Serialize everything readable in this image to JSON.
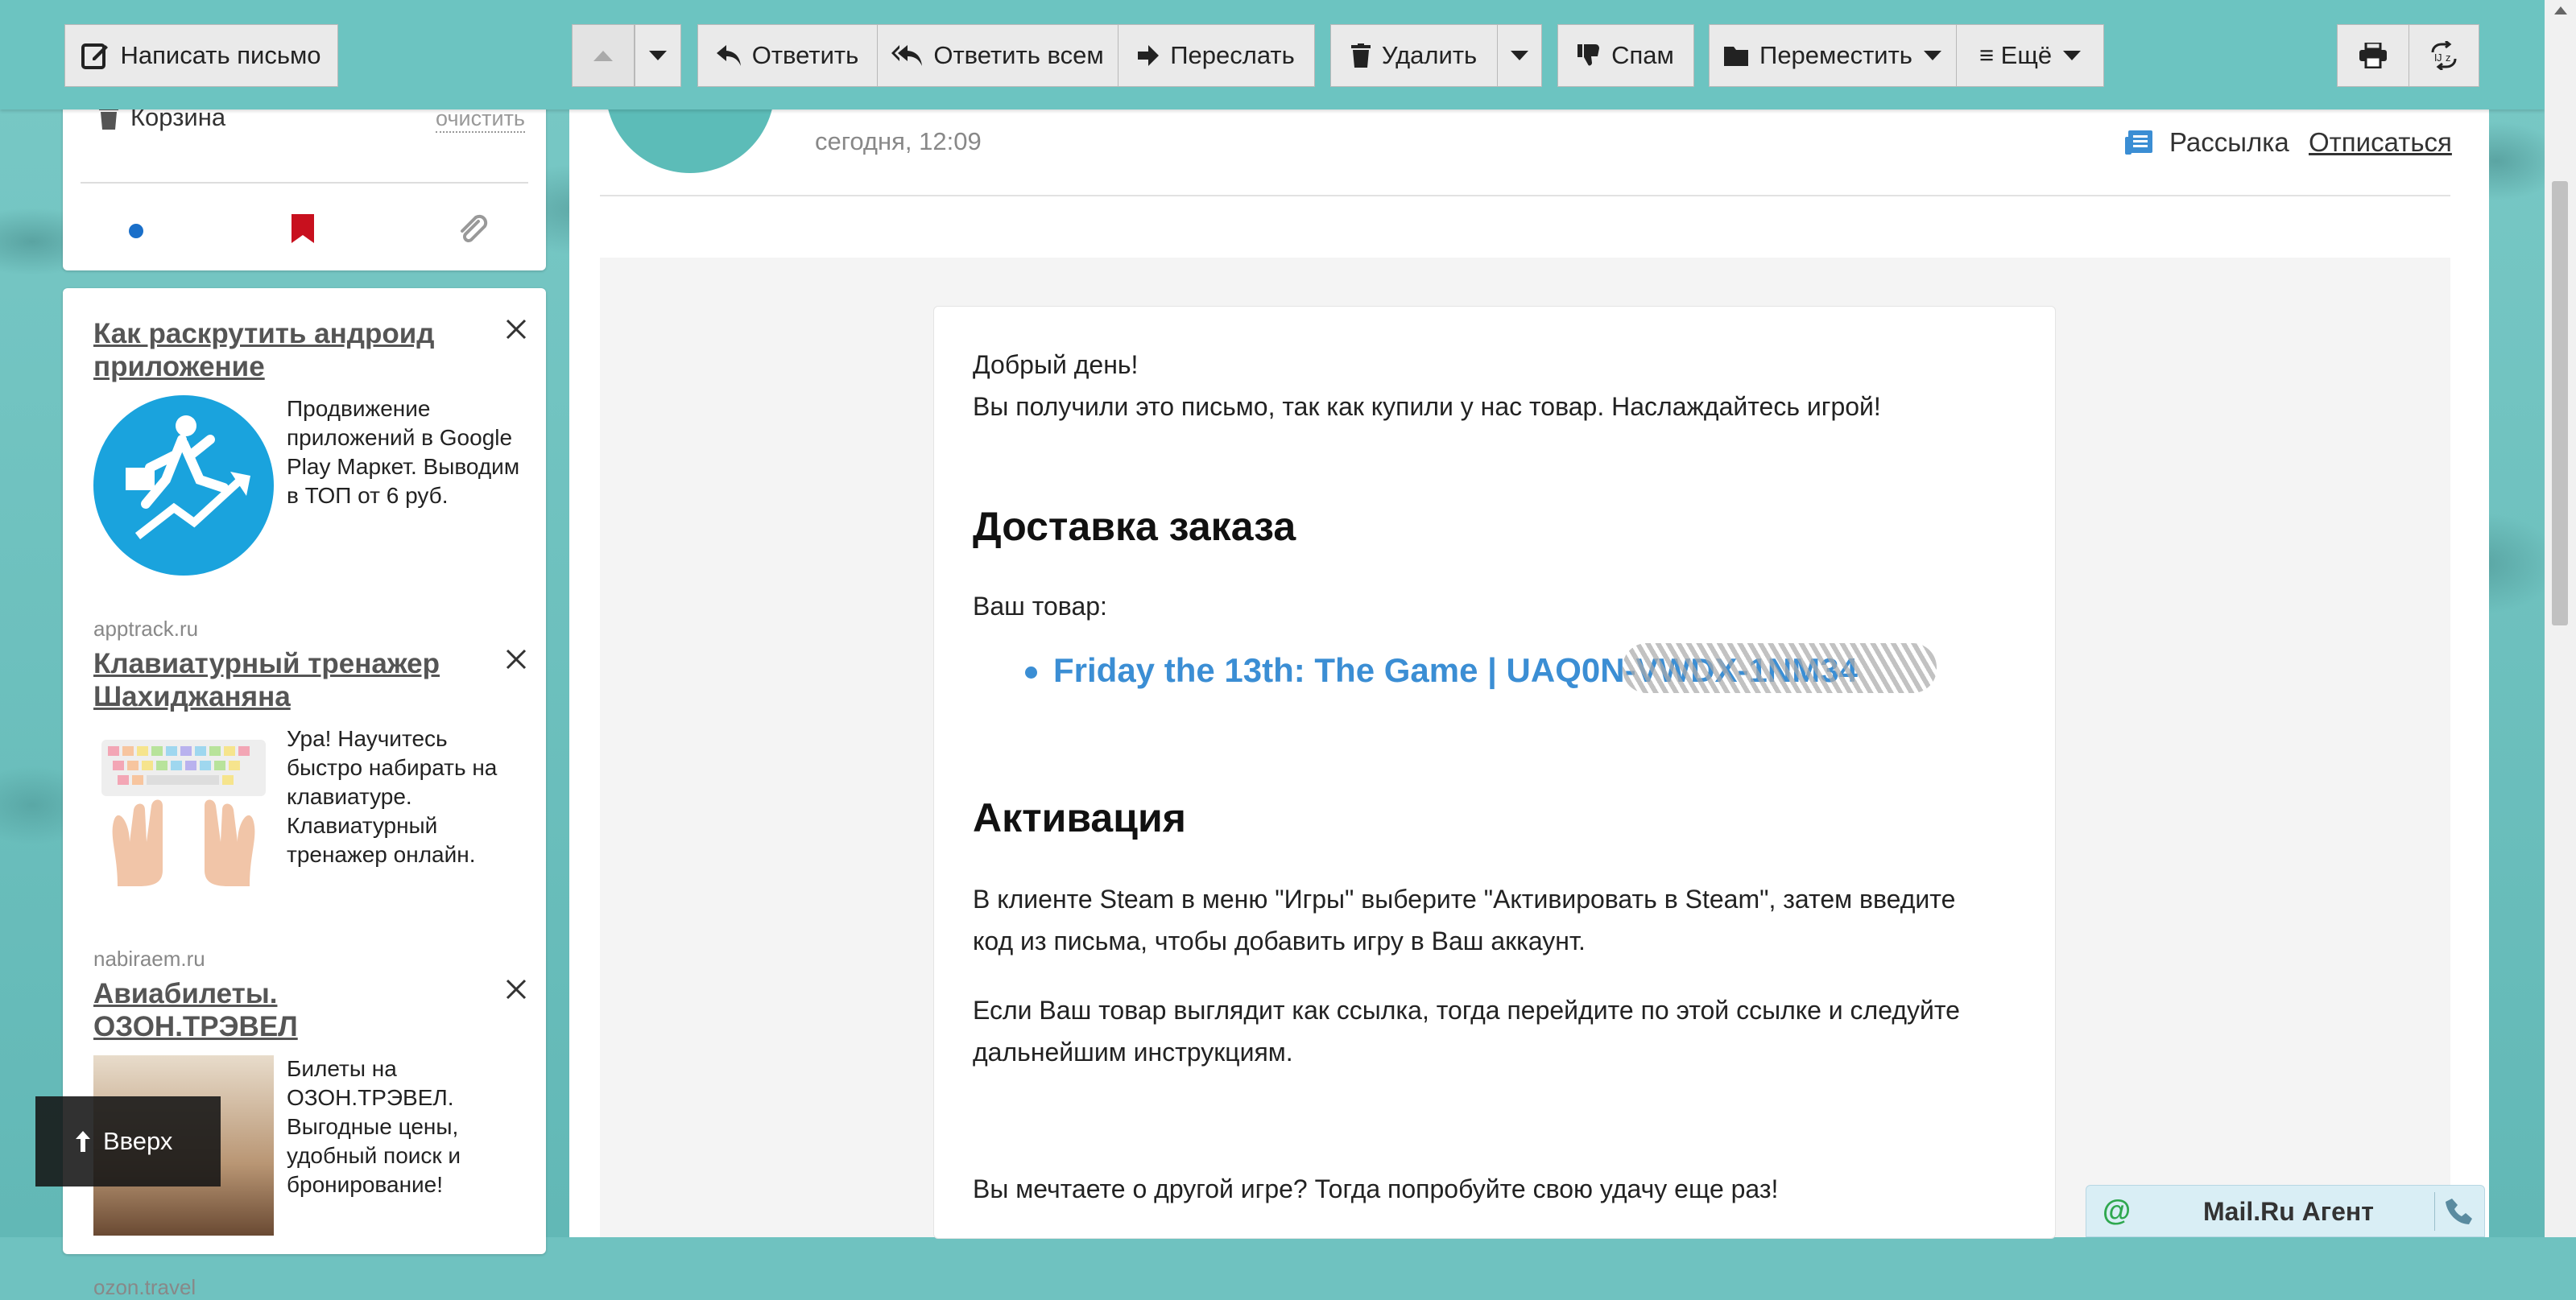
{
  "toolbar": {
    "compose_label": "Написать письмо",
    "reply_label": "Ответить",
    "reply_all_label": "Ответить всем",
    "forward_label": "Переслать",
    "delete_label": "Удалить",
    "spam_label": "Спам",
    "move_label": "Переместить",
    "more_label": "≡ Ещё"
  },
  "folders": {
    "trash_label": "Корзина",
    "clear_label": "очистить"
  },
  "ads": [
    {
      "title": "Как раскрутить андроид приложение",
      "text": "Продвижение приложений в Google Play Маркет. Выводим в ТОП от 6 руб.",
      "domain": "apptrack.ru"
    },
    {
      "title": "Клавиатурный тренажер Шахиджаняна",
      "text": "Ура! Научитесь быстро набирать на клавиатуре. Клавиатурный тренажер онлайн.",
      "domain": "nabiraem.ru"
    },
    {
      "title": "Авиабилеты. ОЗОН.ТРЭВЕЛ",
      "text": "Билеты на ОЗОН.ТРЭВЕЛ. Выгодные цены, удобный поиск и бронирование!",
      "domain": "ozon.travel"
    }
  ],
  "up_button_label": "Вверх",
  "message": {
    "date": "сегодня, 12:09",
    "newsletter_label": "Рассылка",
    "unsubscribe_label": "Отписаться",
    "greeting": "Добрый день!",
    "intro": "Вы получили это письмо, так как купили у нас товар. Наслаждайтесь игрой!",
    "delivery_heading": "Доставка заказа",
    "your_item_label": "Ваш товар:",
    "item_link": "Friday the 13th: The Game | UAQ0N-VWDX-1NM34",
    "activation_heading": "Активация",
    "activation_p1": "В клиенте Steam в меню \"Игры\" выберите \"Активировать в Steam\", затем введите код из письма, чтобы добавить игру в Ваш аккаунт.",
    "activation_p2": "Если Ваш товар выглядит как ссылка, тогда перейдите по этой ссылке и следуйте дальнейшим инструкциям.",
    "try_again": "Вы мечтаете о другой игре? Тогда попробуйте свою удачу еще раз!"
  },
  "agent_label": "Mail.Ru Агент",
  "colors": {
    "accent": "#6cc4c1",
    "link": "#3b8ed4",
    "flag": "#c8101e",
    "dot": "#1a6fc9"
  }
}
